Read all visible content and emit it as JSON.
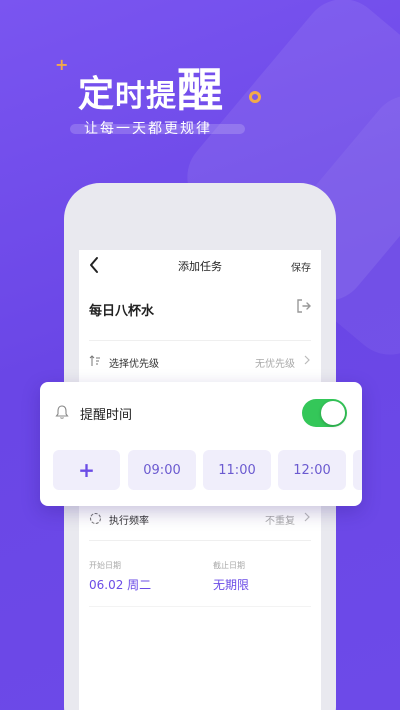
{
  "promo": {
    "headline_1": "定",
    "headline_2": "时",
    "headline_3": "提",
    "headline_4": "醒",
    "subline": "让每一天都更规律"
  },
  "nav": {
    "title": "添加任务",
    "save": "保存"
  },
  "task": {
    "name": "每日八杯水"
  },
  "priority": {
    "label": "选择优先级",
    "value": "无优先级"
  },
  "reminder": {
    "title": "提醒时间",
    "enabled": true,
    "add_label": "+",
    "times": [
      "09:00",
      "11:00",
      "12:00"
    ]
  },
  "frequency": {
    "label": "执行频率",
    "value": "不重复"
  },
  "dates": {
    "start_label": "开始日期",
    "start_value": "06.02  周二",
    "end_label": "截止日期",
    "end_value": "无期限"
  },
  "colors": {
    "accent": "#6b4ce6",
    "toggle_on": "#34c759",
    "chip_bg": "#f0eefb"
  },
  "icons": {
    "back": "chevron-left-icon",
    "exit": "exit-icon",
    "priority": "sort-icon",
    "bell": "bell-icon",
    "frequency": "cycle-icon"
  }
}
